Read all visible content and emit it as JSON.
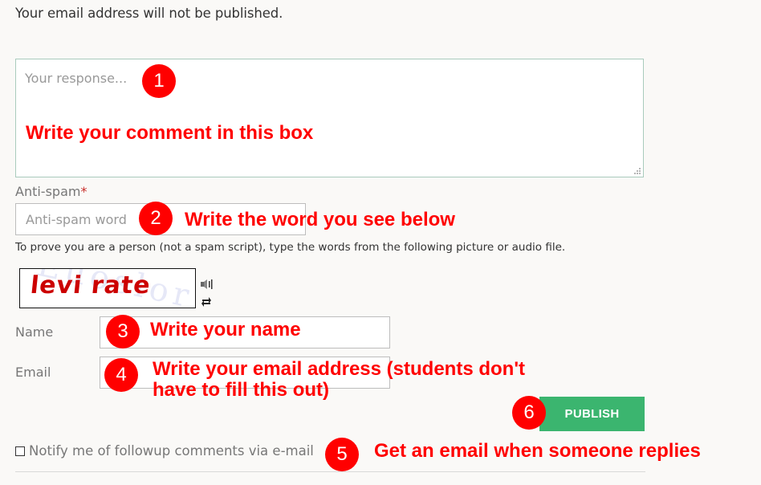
{
  "notice": "Your email address will not be published.",
  "comment": {
    "placeholder": "Your response...",
    "value": ""
  },
  "antispam": {
    "label": "Anti-spam",
    "required_mark": "*",
    "placeholder": "Anti-spam word",
    "help": "To prove you are a person (not a spam script), type the words from the following picture or audio file.",
    "captcha_word": "levi rate",
    "captcha_bg_text": "Euoslor",
    "audio_icon": "speaker-icon",
    "refresh_icon": "refresh-icon"
  },
  "name_field": {
    "label": "Name",
    "value": ""
  },
  "email_field": {
    "label": "Email",
    "value": ""
  },
  "publish_label": "PUBLISH",
  "notify": {
    "label": "Notify me of followup comments via e-mail",
    "checked": false
  },
  "annotations": [
    {
      "number": "1",
      "text": "Write your comment in this box"
    },
    {
      "number": "2",
      "text": "Write the word you see below"
    },
    {
      "number": "3",
      "text": "Write your name"
    },
    {
      "number": "4",
      "text": "Write your email address (students don't",
      "text2": "have to fill this out)"
    },
    {
      "number": "5",
      "text": "Get an email when someone replies"
    },
    {
      "number": "6",
      "text": ""
    }
  ],
  "colors": {
    "publish": "#3bb56f",
    "annotation": "#ff0000",
    "textarea_border": "#a9cbbd"
  }
}
